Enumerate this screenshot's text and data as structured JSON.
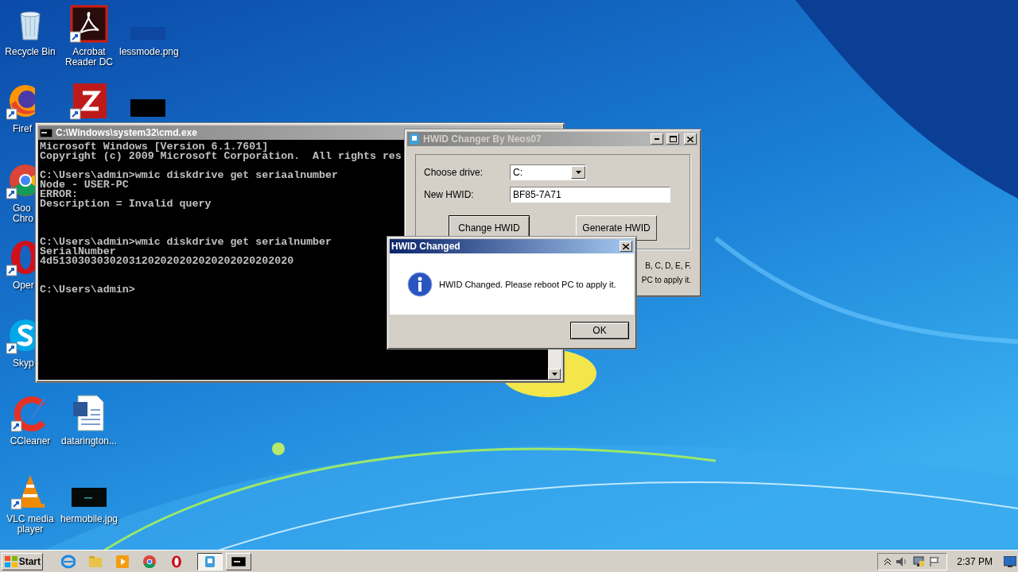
{
  "desktop_icons": [
    {
      "label": "Recycle Bin",
      "kind": "recycle",
      "shortcut": false
    },
    {
      "label": "Acrobat Reader DC",
      "kind": "acrobat",
      "shortcut": true
    },
    {
      "label": "lessmode.png",
      "kind": "image-navy",
      "shortcut": false
    },
    {
      "label": "Firef",
      "kind": "firefox",
      "shortcut": true
    },
    {
      "kind": "filezilla",
      "shortcut": true
    },
    {
      "kind": "image-black",
      "shortcut": false
    },
    {
      "label": "Goo\nChro",
      "kind": "chrome",
      "shortcut": true
    },
    {
      "label": "Oper",
      "kind": "opera",
      "shortcut": true
    },
    {
      "label": "Skyp",
      "kind": "skype",
      "shortcut": true
    },
    {
      "label": "CCleaner",
      "kind": "ccleaner",
      "shortcut": true
    },
    {
      "label": "datarington...",
      "kind": "word",
      "shortcut": false
    },
    {
      "label": "VLC media player",
      "kind": "vlc",
      "shortcut": true
    },
    {
      "label": "hermobile.jpg",
      "kind": "image-dark",
      "shortcut": false
    }
  ],
  "cmd_window": {
    "title": "C:\\Windows\\system32\\cmd.exe",
    "blocks": [
      [
        "Microsoft Windows [Version 6.1.7601]",
        "Copyright (c) 2009 Microsoft Corporation.  All rights res"
      ],
      [
        "C:\\Users\\admin>wmic diskdrive get seriaalnumber",
        "Node - USER-PC",
        "ERROR:",
        "Description = Invalid query"
      ],
      [
        "C:\\Users\\admin>wmic diskdrive get serialnumber",
        "SerialNumber",
        "4d51303030302031202020202020202020202020"
      ],
      [
        "C:\\Users\\admin>"
      ]
    ]
  },
  "hwid_window": {
    "title": "HWID Changer By Neos07",
    "drive_label": "Choose drive:",
    "drive_value": "C:",
    "hwid_label": "New HWID:",
    "hwid_value": "BF85-7A71",
    "buttons": [
      {
        "label": "Change HWID",
        "default": true
      },
      {
        "label": "Generate HWID",
        "default": false
      }
    ],
    "notes": [
      "B, C, D, E, F.",
      "PC to apply it."
    ]
  },
  "dialog": {
    "title": "HWID Changed",
    "message": "HWID Changed. Please reboot PC to apply it.",
    "ok": "OK"
  },
  "taskbar": {
    "start": "Start",
    "tasks": [
      {
        "kind": "hwid",
        "selected": true
      },
      {
        "kind": "cmd",
        "selected": false
      }
    ],
    "clock": "2:37 PM"
  }
}
